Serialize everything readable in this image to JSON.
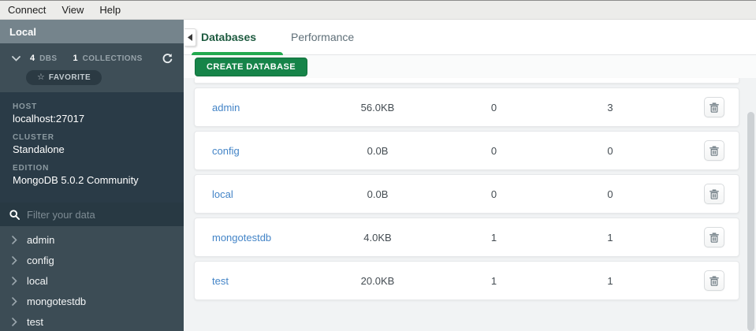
{
  "menu_bar": {
    "items": [
      "Connect",
      "View",
      "Help"
    ]
  },
  "sidebar": {
    "title": "Local",
    "stats": {
      "dbs_count": "4",
      "dbs_label": "DBS",
      "collections_count": "1",
      "collections_label": "COLLECTIONS"
    },
    "favorite": {
      "star_glyph": "☆",
      "label": "FAVORITE"
    },
    "details": [
      {
        "label": "HOST",
        "value": "localhost:27017"
      },
      {
        "label": "CLUSTER",
        "value": "Standalone"
      },
      {
        "label": "EDITION",
        "value": "MongoDB 5.0.2 Community"
      }
    ],
    "filter": {
      "placeholder": "Filter your data",
      "value": ""
    },
    "databases": [
      {
        "name": "admin"
      },
      {
        "name": "config"
      },
      {
        "name": "local"
      },
      {
        "name": "mongotestdb"
      },
      {
        "name": "test"
      }
    ]
  },
  "main": {
    "tabs": [
      {
        "label": "Databases",
        "active": true
      },
      {
        "label": "Performance",
        "active": false
      }
    ],
    "create_button_label": "CREATE DATABASE",
    "table_rows": [
      {
        "name": "admin",
        "storage_size": "56.0KB",
        "collections": "0",
        "indexes": "3"
      },
      {
        "name": "config",
        "storage_size": "0.0B",
        "collections": "0",
        "indexes": "0"
      },
      {
        "name": "local",
        "storage_size": "0.0B",
        "collections": "0",
        "indexes": "0"
      },
      {
        "name": "mongotestdb",
        "storage_size": "4.0KB",
        "collections": "1",
        "indexes": "1"
      },
      {
        "name": "test",
        "storage_size": "20.0KB",
        "collections": "1",
        "indexes": "1"
      }
    ]
  },
  "colors": {
    "accent_green": "#22A94F",
    "button_green": "#168449",
    "active_tab_text": "#1E5B40",
    "link_blue": "#4384C7",
    "sidebar_body": "#3C4C55",
    "sidebar_title_bg": "#75848C",
    "sidebar_details_bg": "#2A3B47",
    "content_bg": "#F1F3F4"
  },
  "icons": {
    "star": "☆",
    "chevron_down": "v-chevron",
    "chevron_right": ">-chevron",
    "refresh": "circular-arrow",
    "search": "magnifier",
    "trash": "trash-can",
    "collapse": "left-triangle"
  }
}
